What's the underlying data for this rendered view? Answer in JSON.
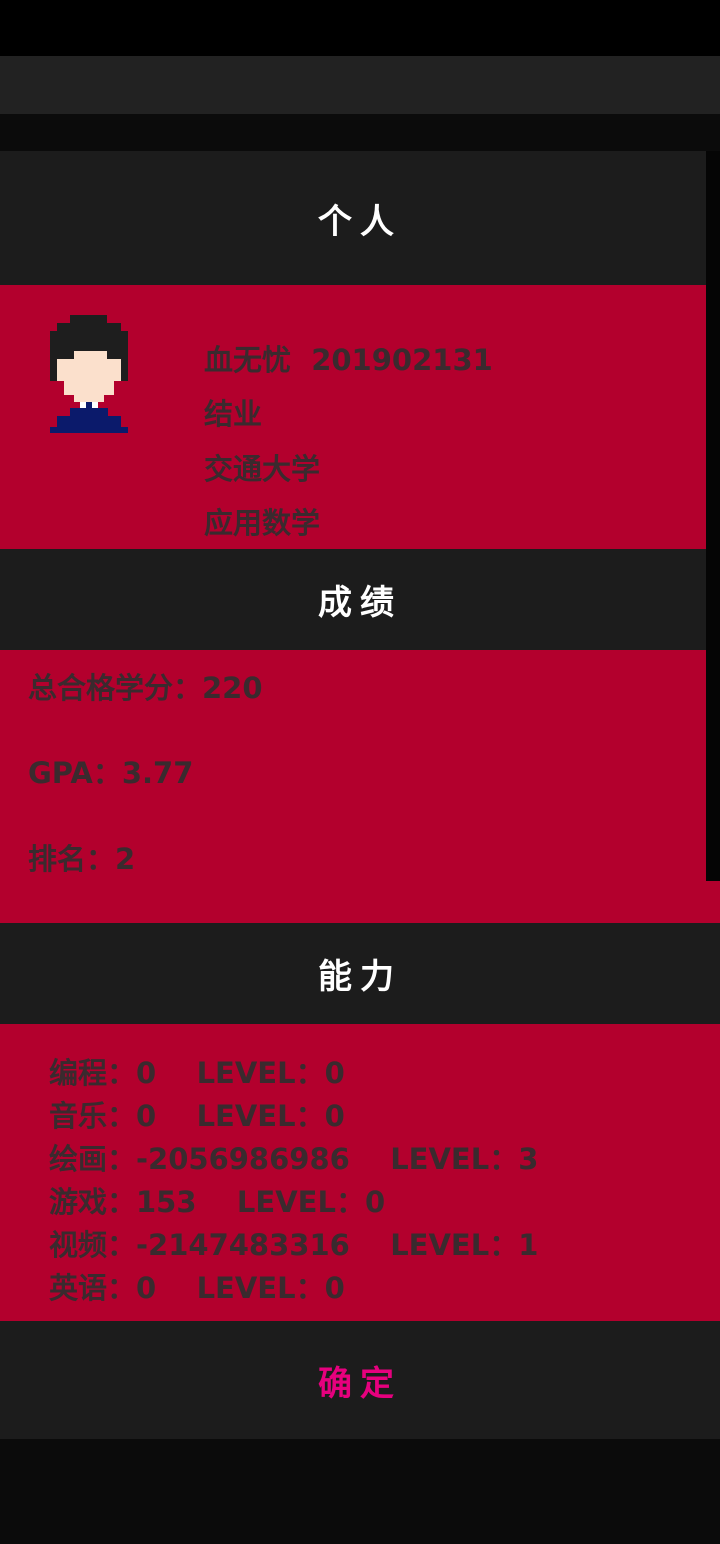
{
  "personal": {
    "header": "个人",
    "name_id": "血无忧  201902131",
    "status": "结业",
    "school": "交通大学",
    "major": "应用数学"
  },
  "grades": {
    "header": "成绩",
    "credits": "总合格学分：220",
    "gpa": "GPA：3.77",
    "rank": "排名：2"
  },
  "abilities": {
    "header": "能力",
    "items": [
      "编程：0    LEVEL：0",
      "音乐：0    LEVEL：0",
      "绘画：-2056986986    LEVEL：3",
      "游戏：153    LEVEL：0",
      "视频：-2147483316    LEVEL：1",
      "英语：0    LEVEL：0"
    ]
  },
  "confirm_label": "确定",
  "colors": {
    "panel_red": "#b3002d",
    "header_dark": "#1c1c1c",
    "confirm_accent": "#e6007e",
    "body_text": "#3a2a2e"
  },
  "icons": {
    "avatar": "pixel-avatar"
  }
}
